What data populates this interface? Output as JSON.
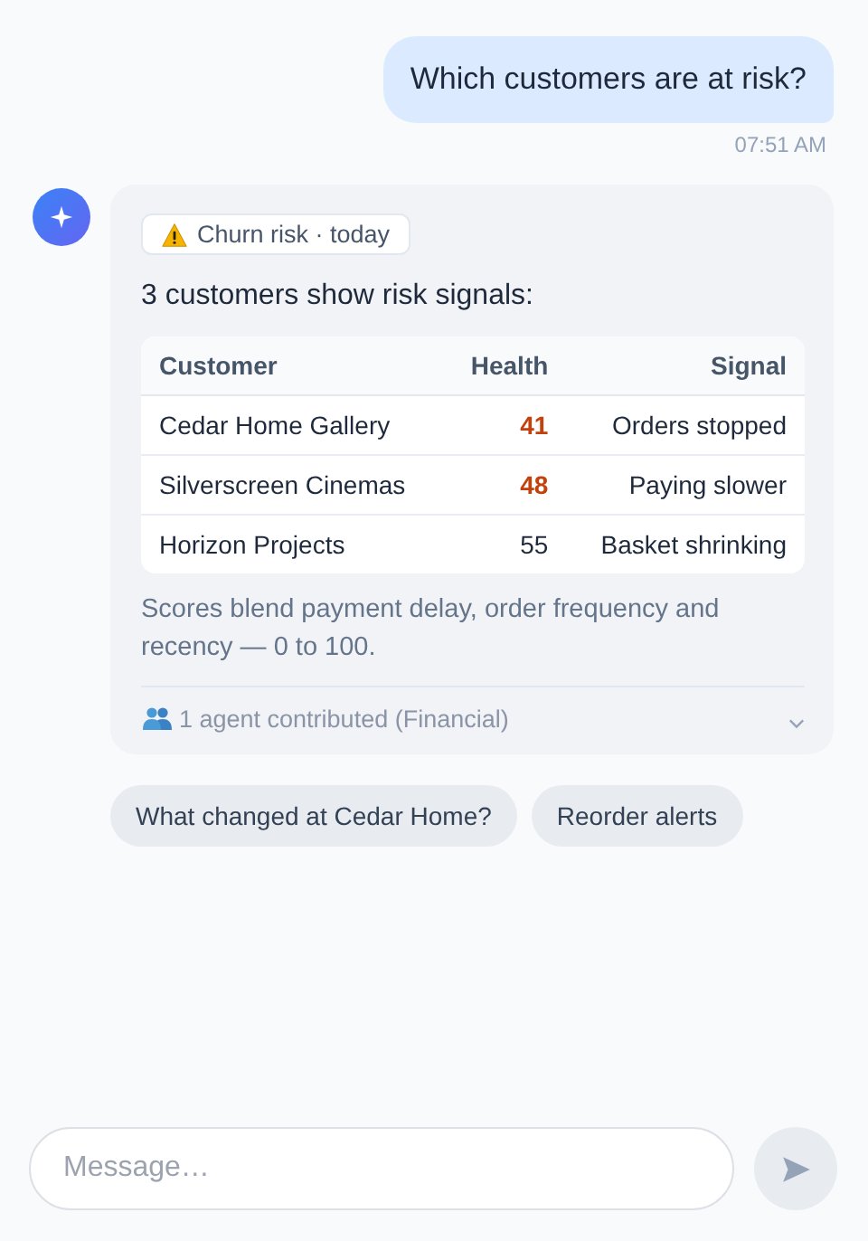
{
  "user_message": {
    "text": "Which customers are at risk?",
    "time": "07:51 AM"
  },
  "reply": {
    "tag": "Churn risk · today",
    "intro": "3 customers show risk signals:",
    "table": {
      "columns": [
        "Customer",
        "Health",
        "Signal"
      ],
      "rows": [
        {
          "customer": "Cedar Home Gallery",
          "health": "41",
          "flagged": true,
          "signal": "Orders stopped"
        },
        {
          "customer": "Silverscreen Cinemas",
          "health": "48",
          "flagged": true,
          "signal": "Paying slower"
        },
        {
          "customer": "Horizon Projects",
          "health": "55",
          "flagged": false,
          "signal": "Basket shrinking"
        }
      ]
    },
    "note": "Scores blend payment delay, order frequency and recency — 0 to 100.",
    "contributors": {
      "text": "1 agent contributed (Financial)",
      "expanded": false
    }
  },
  "suggestions": [
    "What changed at Cedar Home?",
    "Reorder alerts"
  ],
  "composer": {
    "placeholder": "Message…"
  }
}
